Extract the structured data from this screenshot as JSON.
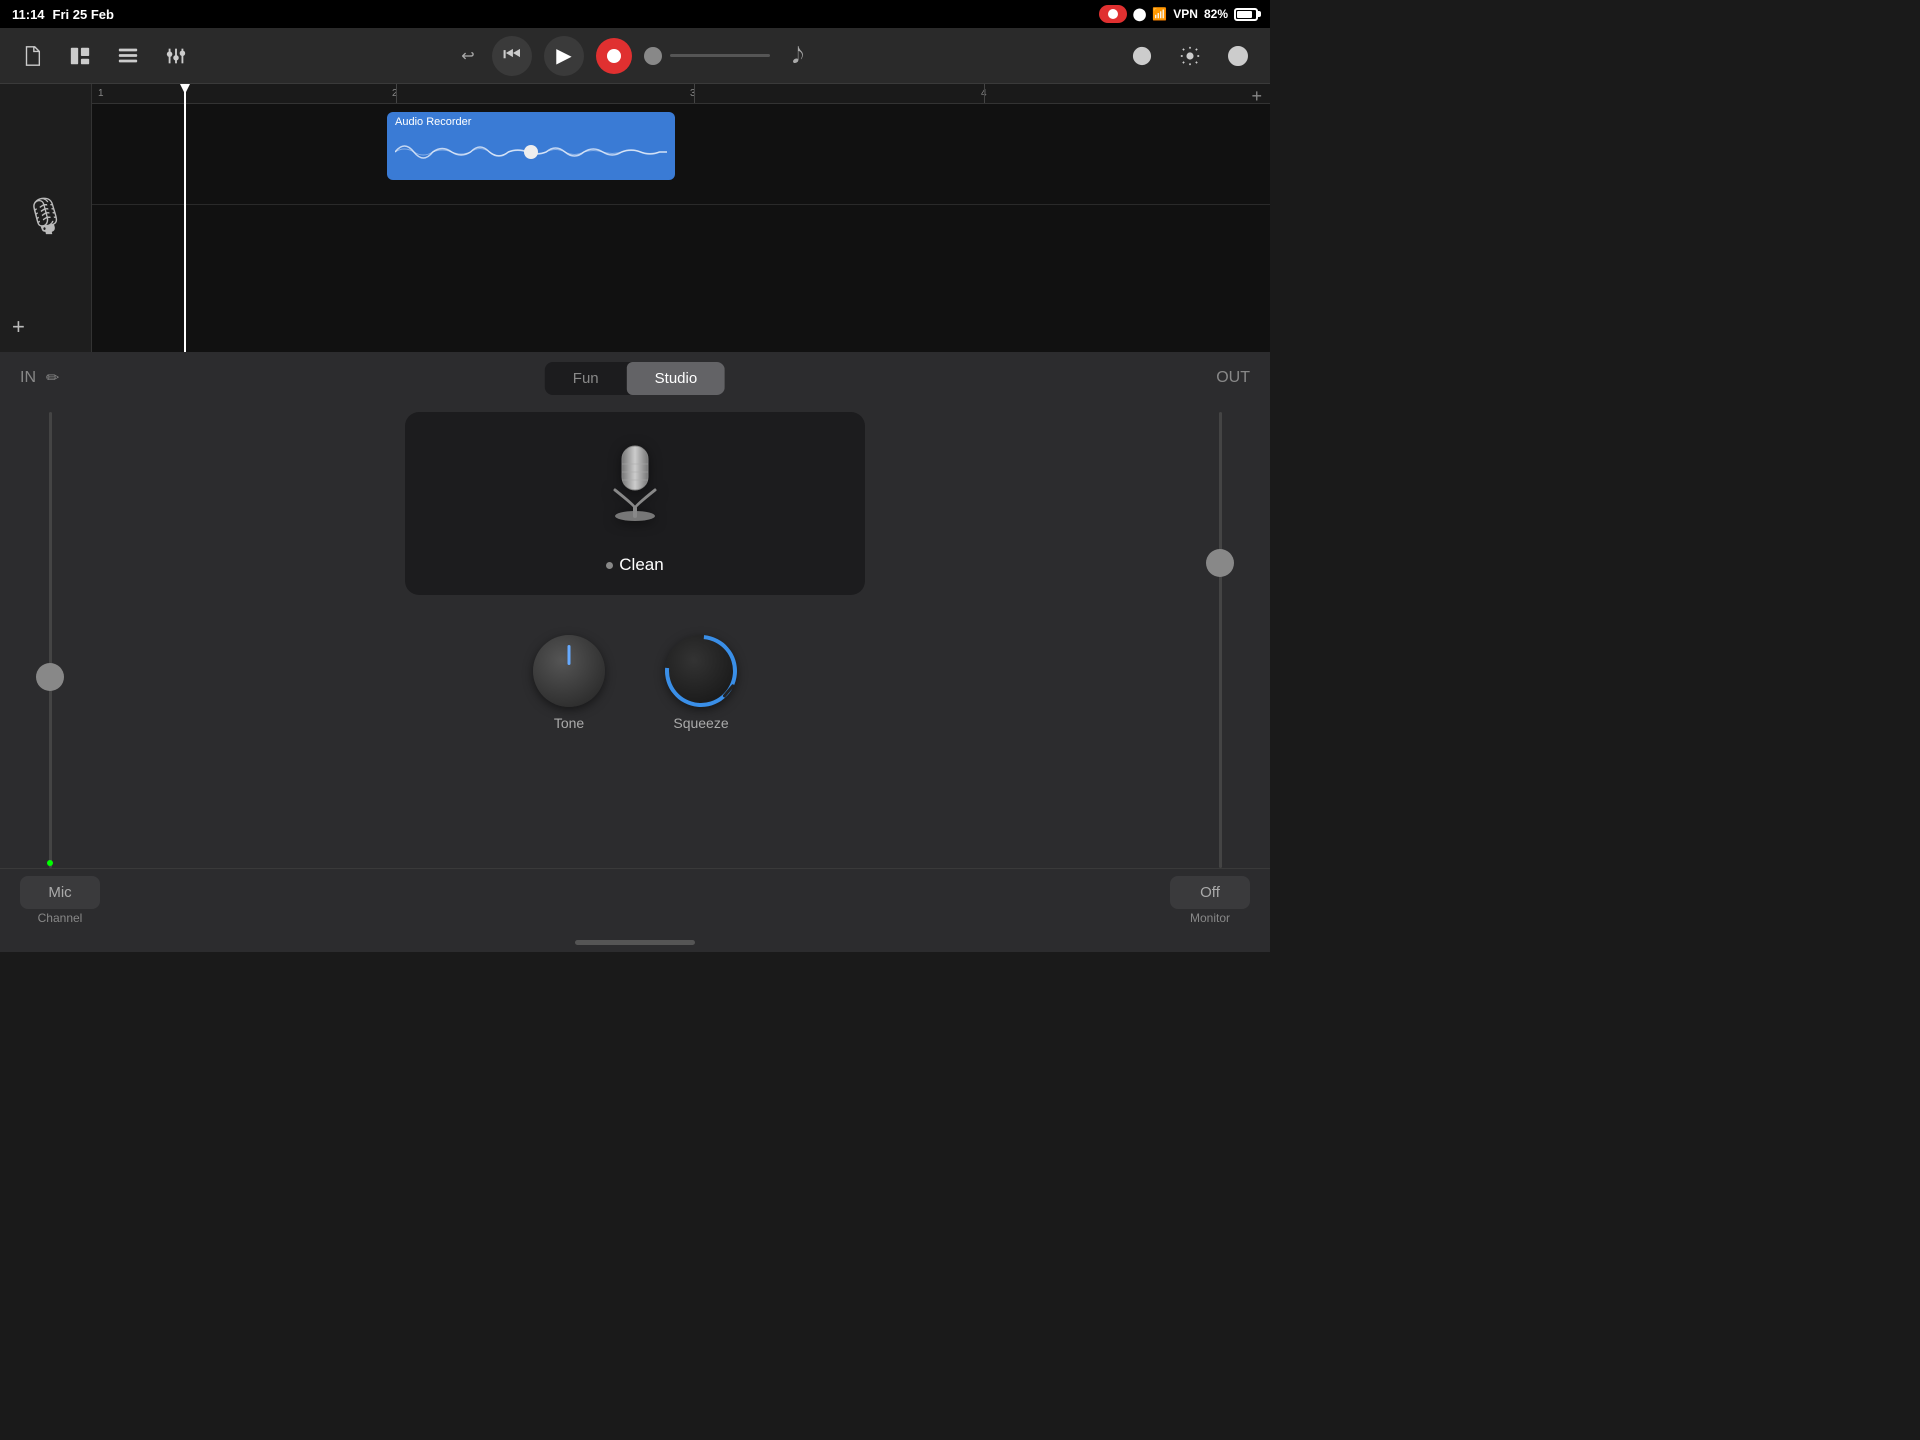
{
  "statusBar": {
    "time": "11:14",
    "date": "Fri 25 Feb",
    "battery": "82%",
    "vpn": "VPN"
  },
  "toolbar": {
    "playLabel": "▶",
    "rewindLabel": "⏮",
    "recordLabel": "●"
  },
  "track": {
    "clipTitle": "Audio Recorder",
    "ruler": {
      "marks": [
        "1",
        "2",
        "3",
        "4"
      ]
    }
  },
  "panel": {
    "inLabel": "IN",
    "outLabel": "OUT",
    "editIcon": "✏",
    "modes": [
      {
        "label": "Fun",
        "active": false
      },
      {
        "label": "Studio",
        "active": true
      }
    ],
    "preset": {
      "name": "Clean",
      "dotColor": "#888"
    },
    "knobs": [
      {
        "label": "Tone"
      },
      {
        "label": "Squeeze"
      }
    ],
    "micBtn": "Mic",
    "channelLabel": "Channel",
    "monitorBtn": "Off",
    "monitorLabel": "Monitor"
  }
}
